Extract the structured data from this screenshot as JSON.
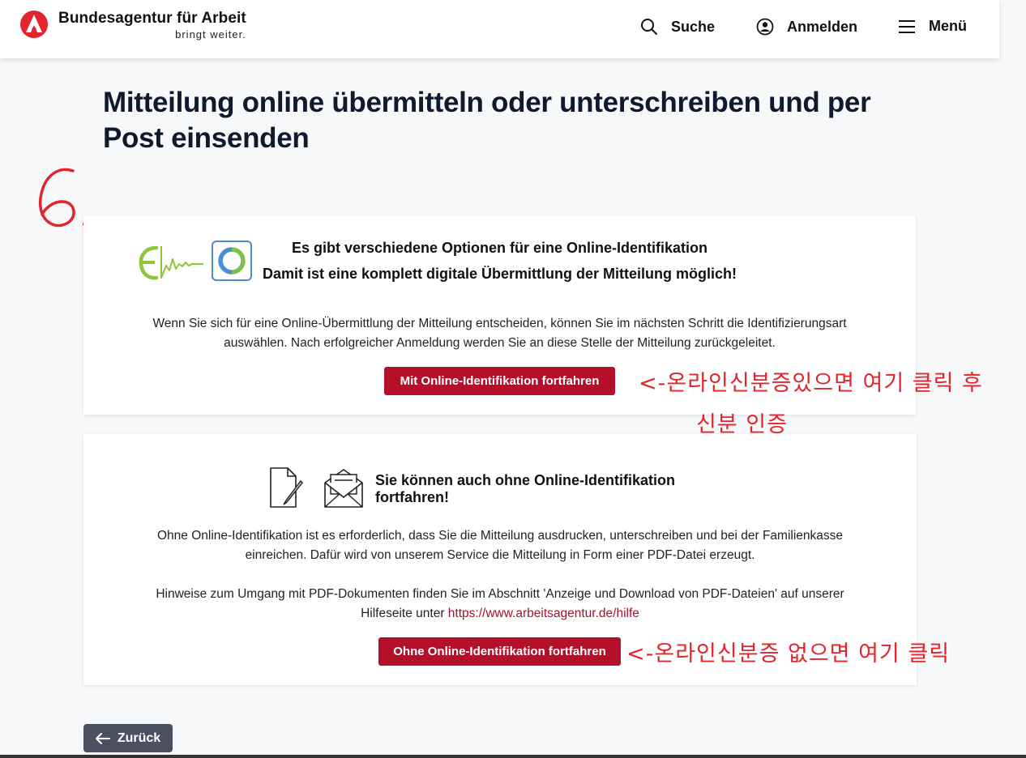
{
  "header": {
    "logo_title": "Bundesagentur für Arbeit",
    "logo_subtitle": "bringt weiter.",
    "search_label": "Suche",
    "login_label": "Anmelden",
    "menu_label": "Menü",
    "brand_color": "#e2242c"
  },
  "main": {
    "page_title": "Mitteilung online übermitteln oder unterschreiben und per Post einsenden",
    "step_marker": "6."
  },
  "online_card": {
    "heading_line1": "Es gibt verschiedene Optionen für eine Online-Identifikation",
    "heading_line2": "Damit ist eine komplett digitale Übermittlung der Mitteilung möglich!",
    "body": "Wenn Sie sich für eine Online-Übermittlung der Mitteilung entscheiden, können Sie im nächsten Schritt die Identifizierungsart auswählen. Nach erfolgreicher Anmeldung werden Sie an diese Stelle der Mitteilung zurückgeleitet.",
    "button_label": "Mit Online-Identifikation fortfahren",
    "annotation_line1": "<-온라인신분증있으면 여기 클릭 후",
    "annotation_line2": "신분 인증"
  },
  "offline_card": {
    "heading": "Sie können auch ohne Online-Identifikation fortfahren!",
    "body1": "Ohne Online-Identifikation ist es erforderlich, dass Sie die Mitteilung ausdrucken, unterschreiben und bei der Familienkasse einreichen. Dafür wird von unserem Service die Mitteilung in Form einer PDF-Datei erzeugt.",
    "body2_prefix": "Hinweise zum Umgang mit PDF-Dokumenten finden Sie im Abschnitt 'Anzeige und Download von PDF-Dateien' auf unserer Hilfeseite unter ",
    "help_link": "https://www.arbeitsagentur.de/hilfe",
    "button_label": "Ohne Online-Identifikation fortfahren",
    "annotation": "<-온라인신분증 없으면 여기 클릭"
  },
  "footer": {
    "back_label": "Zurück"
  },
  "colors": {
    "primary_button": "#b4102a",
    "annotation": "#e2242c",
    "back_button": "#4a5060"
  }
}
